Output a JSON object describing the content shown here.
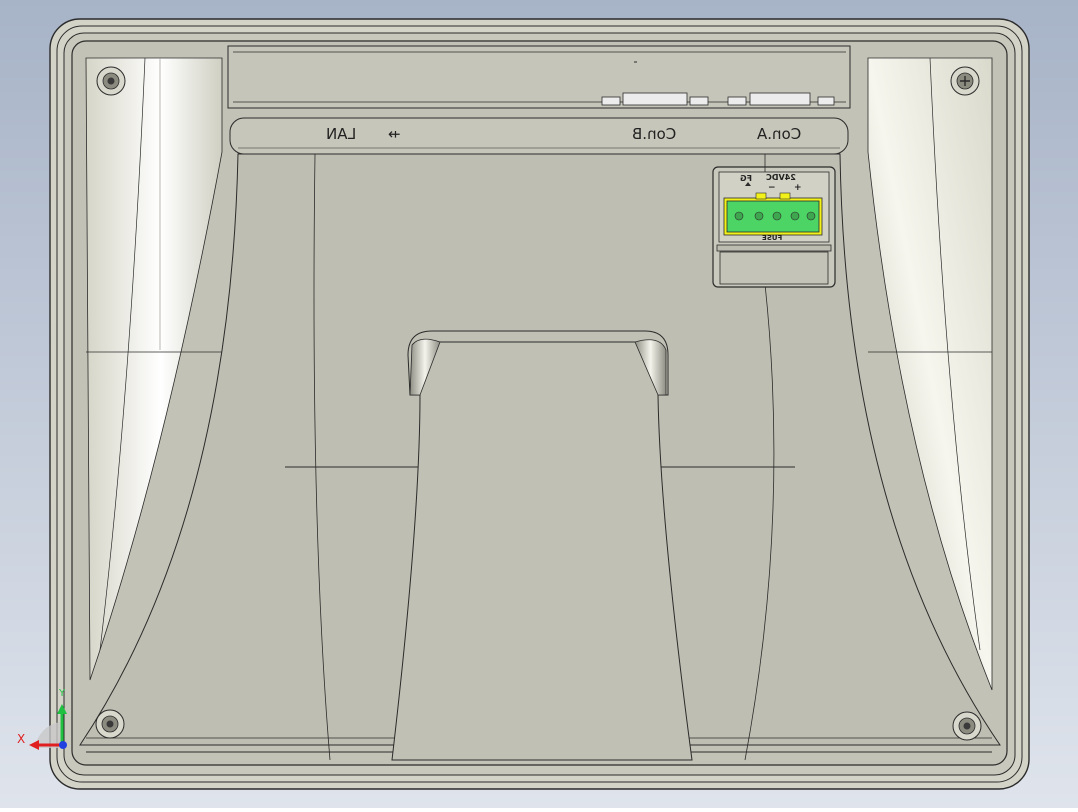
{
  "colors": {
    "background_top": "#a7b3c7",
    "background_bottom": "#dfe4ec",
    "body": "#c3c2b6",
    "body_light": "#e6e6da",
    "outline": "#2b2b2b",
    "terminal_green": "#4cd464",
    "terminal_yellow": "#f2f21a",
    "axis_x": "#e02020",
    "axis_y": "#20c040",
    "axis_z": "#2040e0"
  },
  "labels": {
    "lan": "LAN",
    "usb_icon": "usb-icon",
    "con_b": "Con.B",
    "con_a": "Con.A",
    "fg": "FG",
    "dc24": "24VDC",
    "minus": "−",
    "plus": "+",
    "fuse": "FUSE"
  },
  "triad": {
    "x": "X",
    "y": "Y"
  }
}
